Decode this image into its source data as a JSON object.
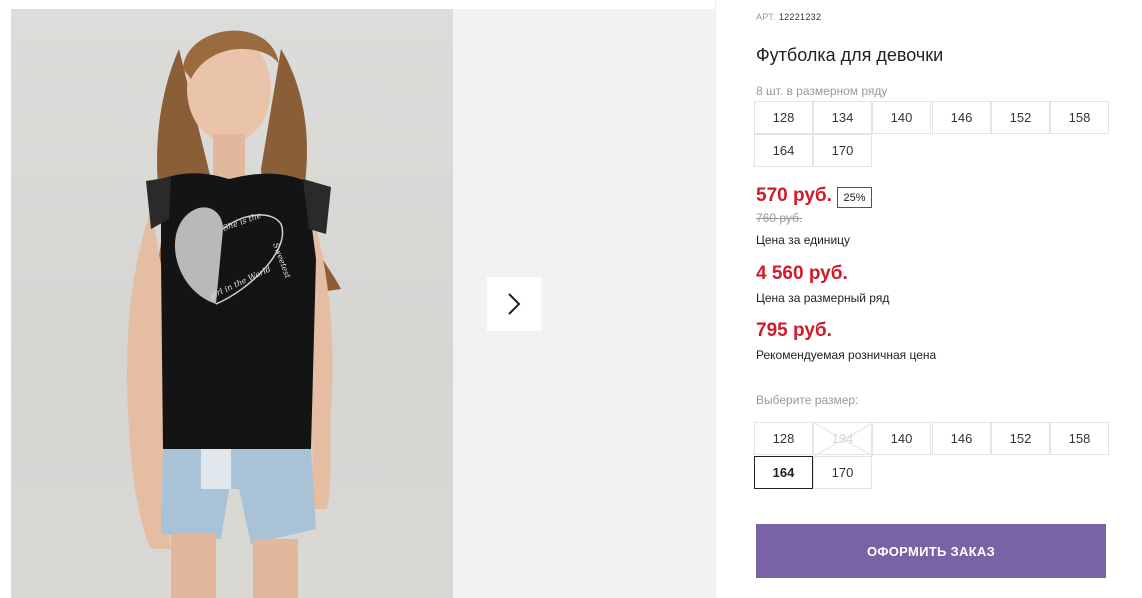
{
  "product": {
    "art_label": "АРТ.",
    "art_number": "12221232",
    "title": "Футболка для девочки"
  },
  "gallery": {
    "next_icon": "chevron-right-icon",
    "print_text": [
      "She is the",
      "Sweetest",
      "girl in the World"
    ]
  },
  "size_range": {
    "caption": "8 шт. в размерном ряду",
    "sizes": [
      "128",
      "134",
      "140",
      "146",
      "152",
      "158",
      "164",
      "170"
    ]
  },
  "pricing": {
    "unit_price": "570 руб.",
    "discount": "25%",
    "old_price": "760 руб.",
    "unit_label": "Цена за единицу",
    "range_price": "4 560 руб.",
    "range_label": "Цена за размерный ряд",
    "retail_price": "795 руб.",
    "retail_label": "Рекомендуемая розничная цена"
  },
  "size_select": {
    "caption": "Выберите размер:",
    "sizes": [
      "128",
      "134",
      "140",
      "146",
      "152",
      "158",
      "164",
      "170"
    ],
    "disabled": [
      "134"
    ],
    "selected": "164"
  },
  "order_button": {
    "label": "ОФОРМИТЬ ЗАКАЗ"
  },
  "colors": {
    "accent_red": "#d11a2a",
    "button_purple": "#7a63a5"
  }
}
